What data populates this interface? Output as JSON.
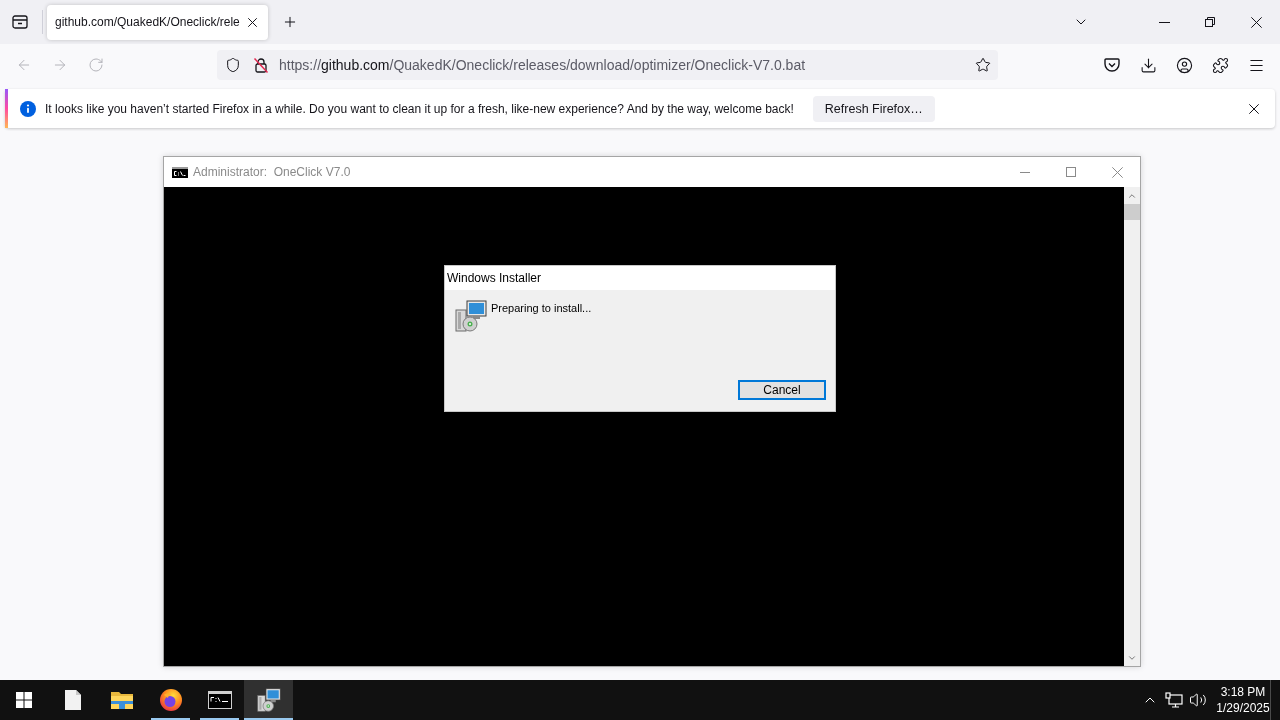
{
  "browser": {
    "tabs": [
      {
        "title": "github.com/QuakedK/Oneclick/rele",
        "selected": true
      }
    ],
    "nav_buttons": [
      {
        "kind": "back",
        "disabled": true
      },
      {
        "kind": "forward",
        "disabled": true
      },
      {
        "kind": "reload",
        "disabled": true
      }
    ],
    "address": {
      "scheme": "https://",
      "host": "github.com",
      "path": "/QuakedK/Oneclick/releases/download/optimizer/Oneclick-V7.0.bat",
      "secure": false
    },
    "notification": {
      "message": "It looks like you haven’t started Firefox in a while. Do you want to clean it up for a fresh, like-new experience? And by the way, welcome back!",
      "button": "Refresh Firefox…"
    }
  },
  "console_window": {
    "title": "Administrator:  OneClick V7.0",
    "active": false
  },
  "installer_dialog": {
    "title": "Windows Installer",
    "message": "Preparing to install...",
    "buttons": [
      {
        "label": "Cancel",
        "default": true
      }
    ]
  },
  "taskbar": {
    "items": [
      {
        "kind": "file",
        "running": false,
        "selected": false
      },
      {
        "kind": "explorer",
        "running": false,
        "selected": false
      },
      {
        "kind": "firefox",
        "running": true,
        "selected": false
      },
      {
        "kind": "console",
        "running": true,
        "selected": false
      },
      {
        "kind": "installer",
        "running": true,
        "selected": true
      }
    ],
    "clock": {
      "time": "3:18 PM",
      "date": "1/29/2025"
    }
  }
}
